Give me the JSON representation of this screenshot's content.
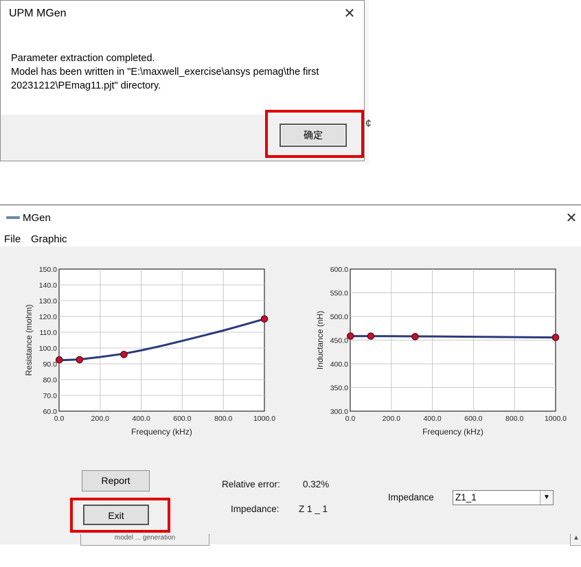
{
  "dialog": {
    "title": "UPM MGen",
    "close_glyph": "✕",
    "message_lines": [
      "Parameter extraction completed.",
      "Model has been written in \"E:\\maxwell_exercise\\ansys pemag\\the first",
      "20231212\\PEmag11.pjt\" directory."
    ],
    "ok_label": "确定",
    "background_char": "¢"
  },
  "window": {
    "title": "MGen",
    "close_glyph": "✕",
    "icon": "app-window-icon",
    "menu": [
      "File",
      "Graphic"
    ]
  },
  "chart_data": [
    {
      "type": "line",
      "title": "",
      "xlabel": "Frequency (kHz)",
      "ylabel": "Resistance (mohm)",
      "xlim": [
        0,
        1000
      ],
      "ylim": [
        60,
        150
      ],
      "xticks": [
        "0.0",
        "200.0",
        "400.0",
        "600.0",
        "800.0",
        "1000.0"
      ],
      "yticks": [
        "60.0",
        "70.0",
        "80.0",
        "90.0",
        "100.0",
        "110.0",
        "120.0",
        "130.0",
        "140.0",
        "150.0"
      ],
      "grid": true,
      "line_color": "#2b3a7a",
      "marker_color": "#c8102e",
      "fit_curve": {
        "x": [
          0,
          100,
          200,
          316,
          400,
          500,
          600,
          700,
          800,
          900,
          1000
        ],
        "y": [
          92.2,
          92.8,
          94.3,
          96.4,
          98.5,
          101.4,
          104.5,
          107.8,
          111.1,
          114.7,
          118.4
        ]
      },
      "points": {
        "x": [
          1,
          100,
          316,
          1000
        ],
        "y": [
          92.5,
          92.6,
          95.9,
          118.4
        ]
      }
    },
    {
      "type": "line",
      "title": "",
      "xlabel": "Frequency (kHz)",
      "ylabel": "Inductance (nH)",
      "xlim": [
        0,
        1000
      ],
      "ylim": [
        300,
        600
      ],
      "xticks": [
        "0.0",
        "200.0",
        "400.0",
        "600.0",
        "800.0",
        "1000.0"
      ],
      "yticks": [
        "300.0",
        "350.0",
        "400.0",
        "450.0",
        "500.0",
        "550.0",
        "600.0"
      ],
      "grid": true,
      "line_color": "#2b3a7a",
      "marker_color": "#c8102e",
      "fit_curve": {
        "x": [
          0,
          200,
          400,
          600,
          800,
          1000
        ],
        "y": [
          458.5,
          458.2,
          457.8,
          457.1,
          456.4,
          455.6
        ]
      },
      "points": {
        "x": [
          1,
          100,
          316,
          1000
        ],
        "y": [
          458.5,
          458.5,
          457.4,
          455.8
        ]
      }
    }
  ],
  "controls": {
    "report_label": "Report",
    "exit_label": "Exit",
    "relative_error_label": "Relative error:",
    "relative_error_value": "0.32%",
    "impedance_label": "Impedance:",
    "impedance_value": "Z 1 _ 1",
    "impedance_select_label": "Impedance",
    "impedance_select_value": "Z1_1",
    "dropdown_glyph": "▼"
  },
  "background": {
    "tab_fragment": "model ... generation",
    "scroll_glyph": "▲"
  },
  "colors": {
    "highlight": "#e00000",
    "panel": "#f0f0f0"
  }
}
